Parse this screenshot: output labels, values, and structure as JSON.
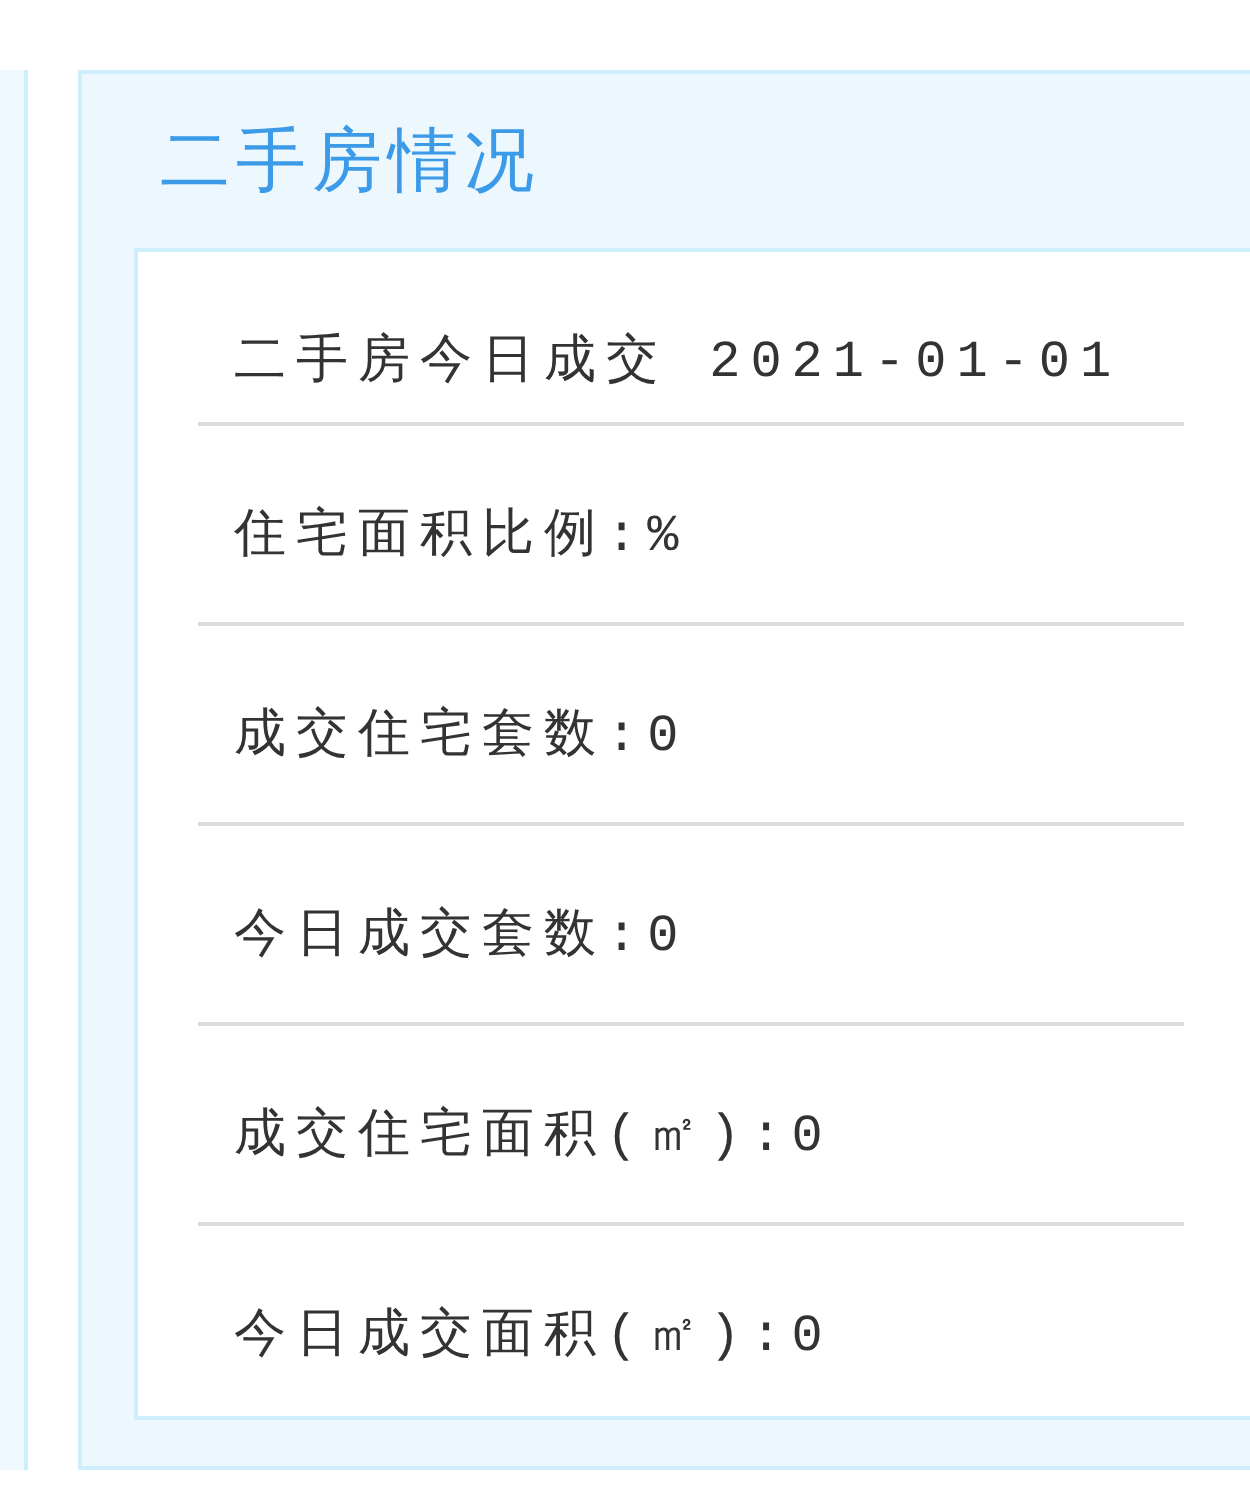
{
  "panel": {
    "title": "二手房情况",
    "rows": [
      "二手房今日成交 2021-01-01",
      "住宅面积比例:%",
      "成交住宅套数:0",
      "今日成交套数:0",
      "成交住宅面积(㎡):0",
      "今日成交面积(㎡):0"
    ]
  }
}
